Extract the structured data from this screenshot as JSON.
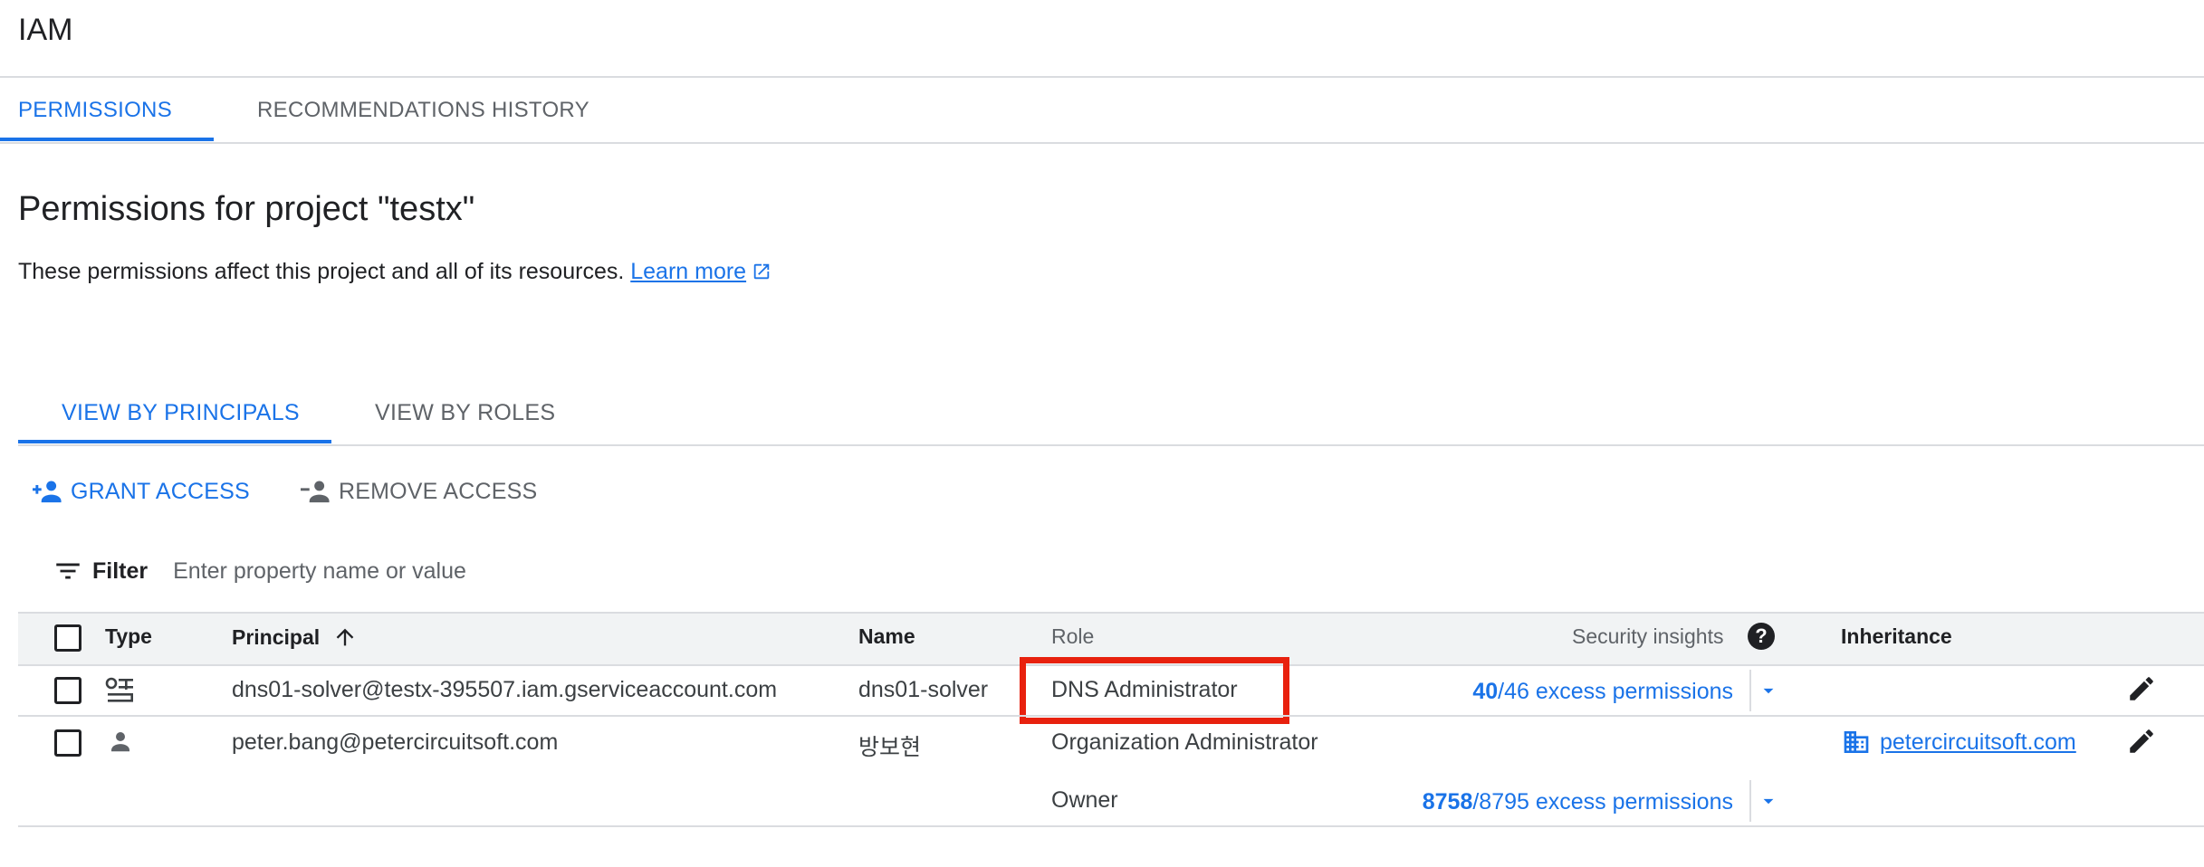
{
  "header": {
    "title": "IAM"
  },
  "top_tabs": [
    {
      "label": "PERMISSIONS",
      "active": true
    },
    {
      "label": "RECOMMENDATIONS HISTORY",
      "active": false
    }
  ],
  "section": {
    "title": "Permissions for project \"testx\"",
    "description": "These permissions affect this project and all of its resources. ",
    "learn_more": "Learn more"
  },
  "sub_tabs": [
    {
      "label": "VIEW BY PRINCIPALS",
      "active": true
    },
    {
      "label": "VIEW BY ROLES",
      "active": false
    }
  ],
  "actions": {
    "grant": "GRANT ACCESS",
    "remove": "REMOVE ACCESS"
  },
  "filter": {
    "label": "Filter",
    "placeholder": "Enter property name or value"
  },
  "table": {
    "headers": {
      "type": "Type",
      "principal": "Principal",
      "name": "Name",
      "role": "Role",
      "security_insights": "Security insights",
      "inheritance": "Inheritance"
    },
    "rows": [
      {
        "type_icon": "service-account-icon",
        "principal": "dns01-solver@testx-395507.iam.gserviceaccount.com",
        "name": "dns01-solver",
        "roles": [
          {
            "role": "DNS Administrator",
            "excess_count": "40",
            "excess_rest": "/46 excess permissions",
            "inheritance": ""
          }
        ]
      },
      {
        "type_icon": "person-icon",
        "principal": "peter.bang@petercircuitsoft.com",
        "name": "방보현",
        "roles": [
          {
            "role": "Organization Administrator",
            "excess_count": "",
            "excess_rest": "",
            "inheritance": "petercircuitsoft.com"
          },
          {
            "role": "Owner",
            "excess_count": "8758",
            "excess_rest": "/8795 excess permissions",
            "inheritance": ""
          }
        ]
      }
    ]
  },
  "colors": {
    "accent": "#1a73e8",
    "highlight": "#e8210e",
    "text": "#202124",
    "muted": "#5f6368"
  }
}
